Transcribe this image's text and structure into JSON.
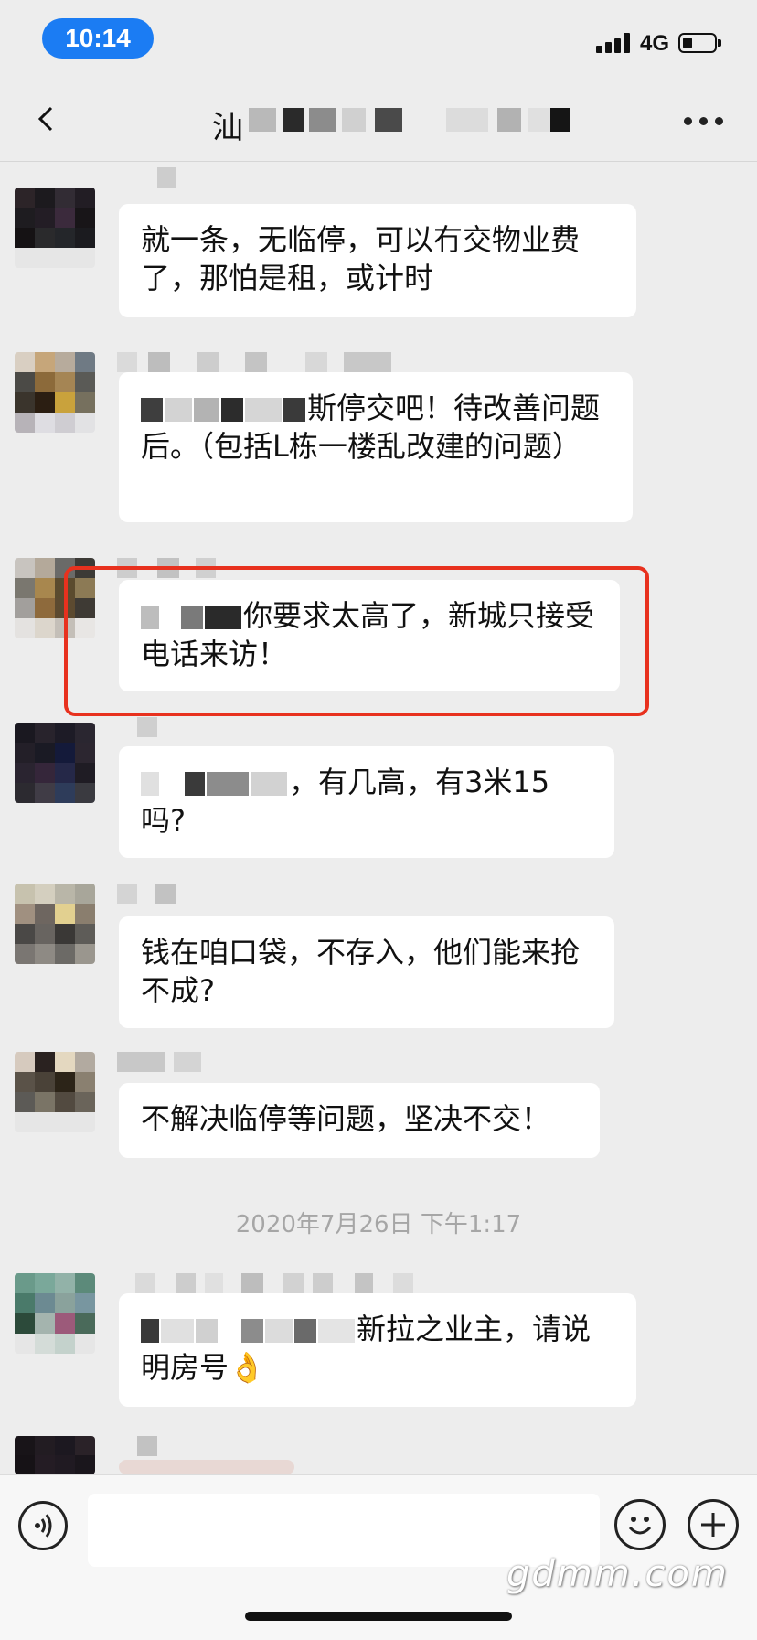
{
  "status_bar": {
    "time": "10:14",
    "network": "4G"
  },
  "nav": {
    "title_visible": "汕"
  },
  "messages": [
    {
      "text": "就一条，无临停，可以冇交物业费了，那怕是租，或计时"
    },
    {
      "text": "斯停交吧！待改善问题后。（包括L栋一楼乱改建的问题）"
    },
    {
      "text": "你要求太高了，新城只接受电话来访！"
    },
    {
      "text": "，有几高，有3米15吗?"
    },
    {
      "text": "钱在咱口袋，不存入，他们能来抢不成?"
    },
    {
      "text": "不解决临停等问题，坚决不交！"
    },
    {
      "text": "新拉之业主，请说明房号👌"
    }
  ],
  "timestamp": "2020年7月26日 下午1:17",
  "watermark": "gdmm.com",
  "colors": {
    "accent": "#1b7cf3",
    "highlight": "#e8311e",
    "background": "#ededed"
  }
}
